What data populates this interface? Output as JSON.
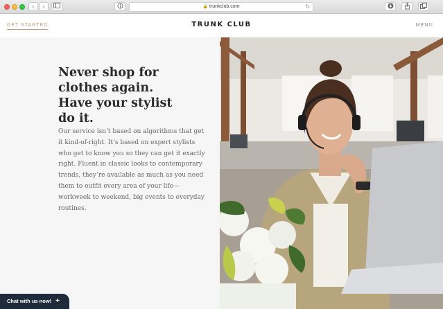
{
  "browser": {
    "url": "trunkclub.com",
    "back_glyph": "‹",
    "forward_glyph": "›"
  },
  "header": {
    "get_started": "GET STARTED",
    "logo": "TRUNK CLUB",
    "menu": "MENU"
  },
  "hero": {
    "headline": "Never shop for clothes again. Have your stylist do it.",
    "body": "Our service isn’t based on algorithms that get it kind-of-right. It’s based on expert stylists who get to know you so they can get it exactly right. Fluent in classic looks to contemporary trends, they’re available as much as you need them to outfit every area of your life—workweek to weekend, big events to everyday routines."
  },
  "chat": {
    "label": "Chat with us now!",
    "plus": "+"
  },
  "colors": {
    "accent": "#c59a7b",
    "chat_bg": "#1f2b3a"
  },
  "icons": [
    "lock-icon",
    "reload-icon",
    "download-icon",
    "share-icon",
    "tabs-icon",
    "sidebar-icon",
    "info-icon"
  ]
}
